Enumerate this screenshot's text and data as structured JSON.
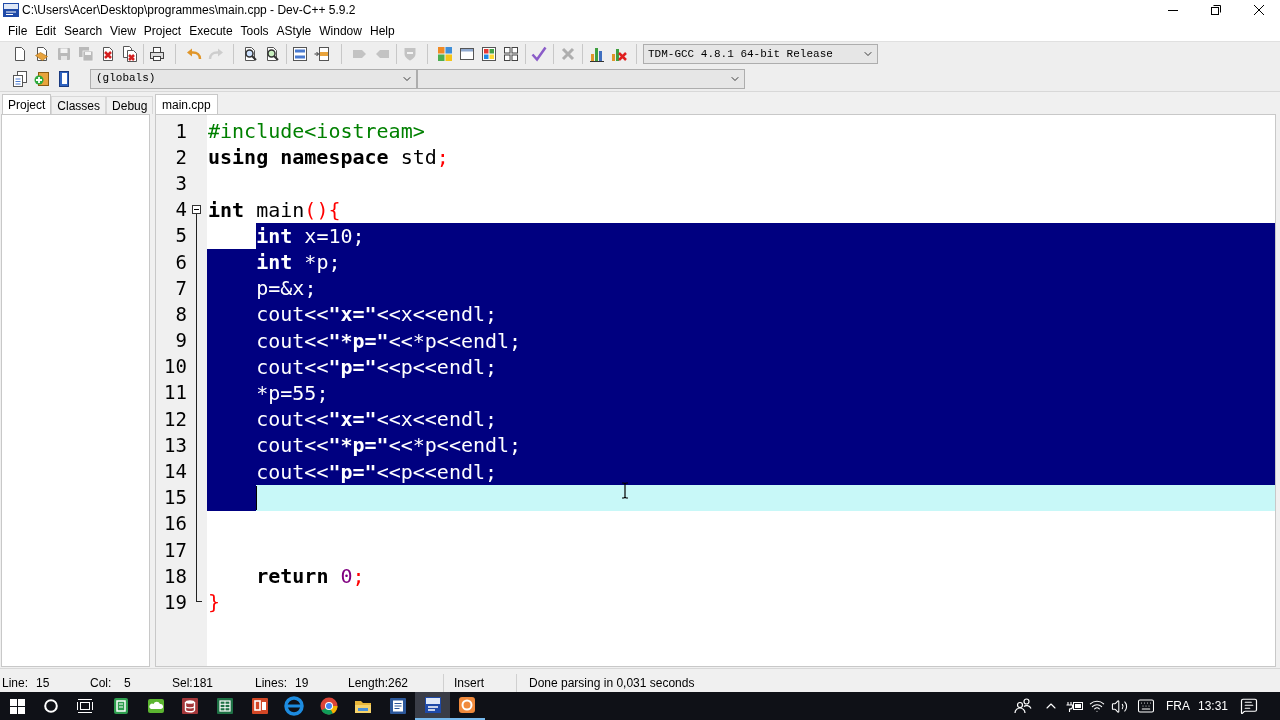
{
  "window": {
    "title": "C:\\Users\\Acer\\Desktop\\programmes\\main.cpp - Dev-C++ 5.9.2"
  },
  "menu": [
    "File",
    "Edit",
    "Search",
    "View",
    "Project",
    "Execute",
    "Tools",
    "AStyle",
    "Window",
    "Help"
  ],
  "toolbar": {
    "groups": [
      [
        {
          "disabled": false
        },
        {
          "disabled": false
        },
        {
          "disabled": true
        },
        {
          "disabled": true
        },
        {
          "disabled": false
        },
        {
          "disabled": false
        }
      ],
      [
        {
          "disabled": false
        }
      ],
      [
        {
          "disabled": false
        },
        {
          "disabled": true
        }
      ],
      [
        {
          "disabled": false
        },
        {
          "disabled": false
        }
      ],
      [
        {
          "disabled": false
        },
        {
          "disabled": false
        }
      ],
      [
        {
          "disabled": true
        },
        {
          "disabled": true
        }
      ],
      [
        {
          "disabled": true
        }
      ],
      [
        {
          "disabled": false
        },
        {
          "disabled": false
        },
        {
          "disabled": false
        },
        {
          "disabled": false
        }
      ],
      [
        {
          "disabled": false
        }
      ],
      [
        {
          "disabled": true
        }
      ],
      [
        {
          "disabled": false
        },
        {
          "disabled": false
        }
      ]
    ],
    "compiler": "TDM-GCC 4.8.1 64-bit Release"
  },
  "class_bar": {
    "scope": "(globals)"
  },
  "side_panel": {
    "tabs": [
      {
        "label": "Project",
        "selected": true
      },
      {
        "label": "Classes",
        "selected": false
      },
      {
        "label": "Debug",
        "selected": false
      }
    ]
  },
  "editor": {
    "tabs": [
      {
        "label": "main.cpp",
        "selected": true
      }
    ],
    "lines": [
      {
        "number": "1",
        "kind": "plain",
        "indented": false,
        "indent_selected": false,
        "selected": false,
        "current": false,
        "tokens": [
          {
            "text": "#include<iostream>",
            "kind": "preprocessor"
          }
        ]
      },
      {
        "number": "2",
        "kind": "plain",
        "indented": false,
        "indent_selected": false,
        "selected": false,
        "current": false,
        "tokens": [
          {
            "text": "using namespace",
            "kind": "keyword"
          },
          {
            "text": " std",
            "kind": "plain"
          },
          {
            "text": ";",
            "kind": "symbol"
          }
        ]
      },
      {
        "number": "3",
        "kind": "plain",
        "indent_selected": false,
        "selected": false,
        "current": false
      },
      {
        "number": "4",
        "kind": "opener",
        "indented": false,
        "indent_selected": false,
        "selected": false,
        "current": false,
        "tokens": [
          {
            "text": "int",
            "kind": "keyword"
          },
          {
            "text": " main",
            "kind": "plain"
          },
          {
            "text": "(){",
            "kind": "symbol"
          }
        ]
      },
      {
        "number": "5",
        "kind": "inner",
        "indented": true,
        "indent_selected": false,
        "selected": true,
        "current": false,
        "tokens": [
          {
            "text": "int",
            "kind": "keyword"
          },
          {
            "text": " x",
            "kind": "plain"
          },
          {
            "text": "=",
            "kind": "symbol"
          },
          {
            "text": "10",
            "kind": "number"
          },
          {
            "text": ";",
            "kind": "symbol"
          }
        ]
      },
      {
        "number": "6",
        "kind": "inner",
        "indented": true,
        "indent_selected": true,
        "selected": true,
        "current": false,
        "tokens": [
          {
            "text": "int",
            "kind": "keyword"
          },
          {
            "text": " *",
            "kind": "symbol"
          },
          {
            "text": "p",
            "kind": "plain"
          },
          {
            "text": ";",
            "kind": "symbol"
          }
        ]
      },
      {
        "number": "7",
        "kind": "inner",
        "indented": true,
        "indent_selected": true,
        "selected": true,
        "current": false,
        "tokens": [
          {
            "text": "p",
            "kind": "plain"
          },
          {
            "text": "=&",
            "kind": "symbol"
          },
          {
            "text": "x",
            "kind": "plain"
          },
          {
            "text": ";",
            "kind": "symbol"
          }
        ]
      },
      {
        "number": "8",
        "kind": "inner",
        "indented": true,
        "indent_selected": true,
        "selected": true,
        "current": false,
        "tokens": [
          {
            "text": "cout",
            "kind": "plain"
          },
          {
            "text": "<<",
            "kind": "symbol"
          },
          {
            "text": "\"x=\"",
            "kind": "string"
          },
          {
            "text": "<<",
            "kind": "symbol"
          },
          {
            "text": "x",
            "kind": "plain"
          },
          {
            "text": "<<",
            "kind": "symbol"
          },
          {
            "text": "endl",
            "kind": "plain"
          },
          {
            "text": ";",
            "kind": "symbol"
          }
        ]
      },
      {
        "number": "9",
        "kind": "inner",
        "indented": true,
        "indent_selected": true,
        "selected": true,
        "current": false,
        "tokens": [
          {
            "text": "cout",
            "kind": "plain"
          },
          {
            "text": "<<",
            "kind": "symbol"
          },
          {
            "text": "\"*p=\"",
            "kind": "string"
          },
          {
            "text": "<<*",
            "kind": "symbol"
          },
          {
            "text": "p",
            "kind": "plain"
          },
          {
            "text": "<<",
            "kind": "symbol"
          },
          {
            "text": "endl",
            "kind": "plain"
          },
          {
            "text": ";",
            "kind": "symbol"
          }
        ]
      },
      {
        "number": "10",
        "kind": "inner",
        "indented": true,
        "indent_selected": true,
        "selected": true,
        "current": false,
        "tokens": [
          {
            "text": "cout",
            "kind": "plain"
          },
          {
            "text": "<<",
            "kind": "symbol"
          },
          {
            "text": "\"p=\"",
            "kind": "string"
          },
          {
            "text": "<<",
            "kind": "symbol"
          },
          {
            "text": "p",
            "kind": "plain"
          },
          {
            "text": "<<",
            "kind": "symbol"
          },
          {
            "text": "endl",
            "kind": "plain"
          },
          {
            "text": ";",
            "kind": "symbol"
          }
        ]
      },
      {
        "number": "11",
        "kind": "inner",
        "indented": true,
        "indent_selected": true,
        "selected": true,
        "current": false,
        "tokens": [
          {
            "text": "*",
            "kind": "symbol"
          },
          {
            "text": "p",
            "kind": "plain"
          },
          {
            "text": "=",
            "kind": "symbol"
          },
          {
            "text": "55",
            "kind": "number"
          },
          {
            "text": ";",
            "kind": "symbol"
          }
        ]
      },
      {
        "number": "12",
        "kind": "inner",
        "indented": true,
        "indent_selected": true,
        "selected": true,
        "current": false,
        "tokens": [
          {
            "text": "cout",
            "kind": "plain"
          },
          {
            "text": "<<",
            "kind": "symbol"
          },
          {
            "text": "\"x=\"",
            "kind": "string"
          },
          {
            "text": "<<",
            "kind": "symbol"
          },
          {
            "text": "x",
            "kind": "plain"
          },
          {
            "text": "<<",
            "kind": "symbol"
          },
          {
            "text": "endl",
            "kind": "plain"
          },
          {
            "text": ";",
            "kind": "symbol"
          }
        ]
      },
      {
        "number": "13",
        "kind": "inner",
        "indented": true,
        "indent_selected": true,
        "selected": true,
        "current": false,
        "tokens": [
          {
            "text": "cout",
            "kind": "plain"
          },
          {
            "text": "<<",
            "kind": "symbol"
          },
          {
            "text": "\"*p=\"",
            "kind": "string"
          },
          {
            "text": "<<*",
            "kind": "symbol"
          },
          {
            "text": "p",
            "kind": "plain"
          },
          {
            "text": "<<",
            "kind": "symbol"
          },
          {
            "text": "endl",
            "kind": "plain"
          },
          {
            "text": ";",
            "kind": "symbol"
          }
        ]
      },
      {
        "number": "14",
        "kind": "inner",
        "indented": true,
        "indent_selected": true,
        "selected": true,
        "current": false,
        "tokens": [
          {
            "text": "cout",
            "kind": "plain"
          },
          {
            "text": "<<",
            "kind": "symbol"
          },
          {
            "text": "\"p=\"",
            "kind": "string"
          },
          {
            "text": "<<",
            "kind": "symbol"
          },
          {
            "text": "p",
            "kind": "plain"
          },
          {
            "text": "<<",
            "kind": "symbol"
          },
          {
            "text": "endl",
            "kind": "plain"
          },
          {
            "text": ";",
            "kind": "symbol"
          }
        ]
      },
      {
        "number": "15",
        "kind": "inner",
        "indented": true,
        "indent_selected": true,
        "selected": false,
        "current": true
      },
      {
        "number": "16",
        "kind": "inner",
        "indent_selected": false,
        "selected": false,
        "current": false
      },
      {
        "number": "17",
        "kind": "inner",
        "indent_selected": false,
        "selected": false,
        "current": false
      },
      {
        "number": "18",
        "kind": "inner",
        "indented": true,
        "indent_selected": false,
        "selected": false,
        "current": false,
        "tokens": [
          {
            "text": "return",
            "kind": "keyword"
          },
          {
            "text": " 0",
            "kind": "number"
          },
          {
            "text": ";",
            "kind": "symbol"
          }
        ]
      },
      {
        "number": "19",
        "kind": "closer",
        "indented": false,
        "indent_selected": false,
        "selected": false,
        "current": false,
        "tokens": [
          {
            "text": "}",
            "kind": "symbol"
          }
        ]
      }
    ]
  },
  "status_bar": {
    "fields": [
      {
        "label": "Line:",
        "value": "15"
      },
      {
        "label": "Col:",
        "value": "5"
      },
      {
        "label": "Sel:",
        "value": "181"
      },
      {
        "label": "Lines:",
        "value": "19"
      },
      {
        "label": "Length:",
        "value": "262"
      }
    ],
    "mode": "Insert",
    "message": "Done parsing in 0,031 seconds"
  },
  "taskbar": {
    "apps": [
      {
        "open": false,
        "selected": false
      },
      {
        "open": false,
        "selected": false
      },
      {
        "open": false,
        "selected": false
      },
      {
        "open": false,
        "selected": false
      },
      {
        "open": false,
        "selected": false
      },
      {
        "open": false,
        "selected": false
      },
      {
        "open": false,
        "selected": false
      },
      {
        "open": false,
        "selected": false
      },
      {
        "open": false,
        "selected": false
      },
      {
        "open": true,
        "selected": true
      },
      {
        "open": true,
        "selected": false
      }
    ],
    "language": "FRA",
    "time": "13:31"
  }
}
